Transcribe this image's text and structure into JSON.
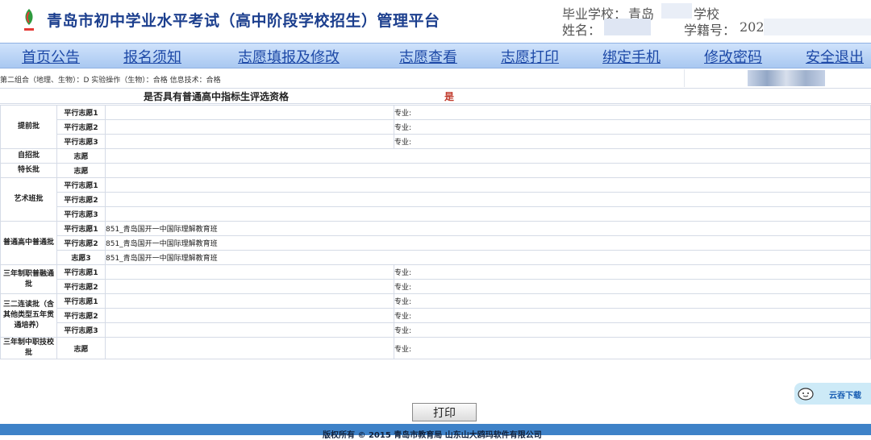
{
  "header": {
    "title": "青岛市初中学业水平考试（高中阶段学校招生）管理平台",
    "school_label": "毕业学校：",
    "school_prefix": "青岛",
    "school_suffix": "学校",
    "name_label": "姓名：",
    "student_id_label": "学籍号：",
    "student_id_prefix": "202"
  },
  "nav": [
    "首页公告",
    "报名须知",
    "志愿填报及修改",
    "志愿查看",
    "志愿打印",
    "绑定手机",
    "修改密码",
    "安全退出"
  ],
  "scores_line": "第二组合（地理、生物）：D    实验操作（生物）：合格    信息技术：合格",
  "qualification": {
    "label": "是否具有普通高中指标生评选资格",
    "value": "是"
  },
  "batches": {
    "tiqian": {
      "label": "提前批",
      "rows": [
        {
          "type": "平行志愿1",
          "choice": "",
          "major_label": "专业:"
        },
        {
          "type": "平行志愿2",
          "choice": "",
          "major_label": "专业:"
        },
        {
          "type": "平行志愿3",
          "choice": "",
          "major_label": "专业:"
        }
      ]
    },
    "zizhao": {
      "label": "自招批",
      "rows": [
        {
          "type": "志愿",
          "choice": ""
        }
      ]
    },
    "techang": {
      "label": "特长批",
      "rows": [
        {
          "type": "志愿",
          "choice": ""
        }
      ]
    },
    "yishu": {
      "label": "艺术班批",
      "rows": [
        {
          "type": "平行志愿1",
          "choice": ""
        },
        {
          "type": "平行志愿2",
          "choice": ""
        },
        {
          "type": "平行志愿3",
          "choice": ""
        }
      ]
    },
    "putong": {
      "label": "普通高中普通批",
      "rows": [
        {
          "type": "平行志愿1",
          "choice": "851_青岛国开一中国际理解教育班"
        },
        {
          "type": "平行志愿2",
          "choice": "851_青岛国开一中国际理解教育班"
        },
        {
          "type": "志愿3",
          "choice": "851_青岛国开一中国际理解教育班"
        }
      ]
    },
    "sannian_puro": {
      "label": "三年制职普融通批",
      "rows": [
        {
          "type": "平行志愿1",
          "choice": "",
          "major_label": "专业:"
        },
        {
          "type": "平行志愿2",
          "choice": "",
          "major_label": "专业:"
        }
      ]
    },
    "sanerlian": {
      "label": "三二连读批（含其他类型五年贯通培养）",
      "rows": [
        {
          "type": "平行志愿1",
          "choice": "",
          "major_label": "专业:"
        },
        {
          "type": "平行志愿2",
          "choice": "",
          "major_label": "专业:"
        },
        {
          "type": "平行志愿3",
          "choice": "",
          "major_label": "专业:"
        }
      ]
    },
    "zhongzhi": {
      "label": "三年制中职技校批",
      "rows": [
        {
          "type": "志愿",
          "choice": "",
          "major_label": "专业:"
        }
      ]
    }
  },
  "print_button": "打印",
  "footer": "版权所有 © 2015 青岛市教育局 山东山大鸥玛软件有限公司",
  "cloud_download": "云吞下载",
  "colors": {
    "title": "#1c3f8e",
    "nav_text": "#1d49a7",
    "nav_bg": "#b9d4f6",
    "qual_value": "#c0392b",
    "footer_bg": "#3e82c8"
  }
}
